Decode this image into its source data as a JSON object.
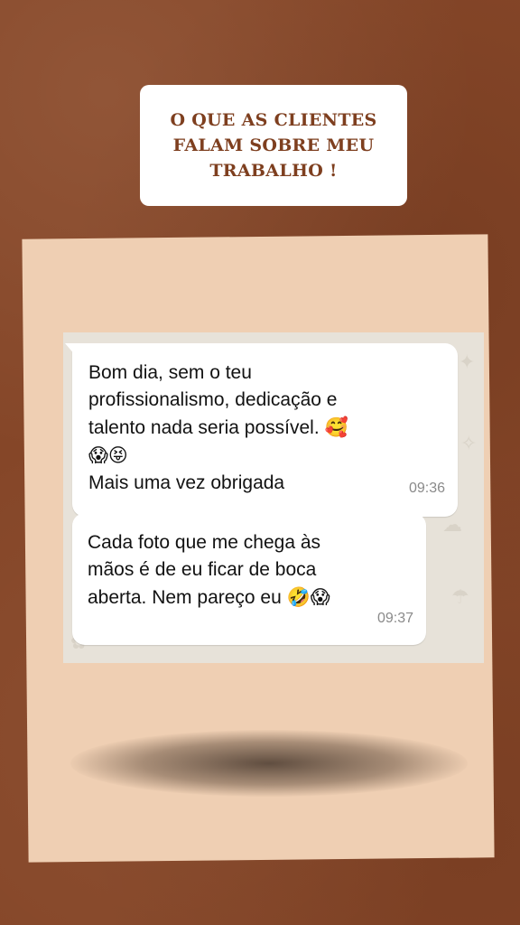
{
  "title": {
    "lines": [
      "O QUE AS CLIENTES",
      "FALAM SOBRE MEU",
      "TRABALHO !"
    ]
  },
  "messages": [
    {
      "lines": [
        "Bom dia, sem o teu",
        "profissionalismo, dedicação e",
        "talento nada seria possível.",
        "",
        "Mais uma vez obrigada"
      ],
      "emojis_line3": "🥰",
      "emojis_line4": "😱😝",
      "time": "09:36"
    },
    {
      "lines": [
        "Cada foto que me chega às",
        "mãos é de eu ficar de boca",
        "aberta. Nem pareço eu"
      ],
      "emojis_line3": "🤣😱",
      "time": "09:37"
    }
  ],
  "colors": {
    "background": "#854628",
    "title_text": "#7e3f1f",
    "panel": "#efcfb3",
    "chat_wallpaper": "#e7e2d9",
    "bubble": "#ffffff",
    "timestamp": "#8a8a8a"
  }
}
